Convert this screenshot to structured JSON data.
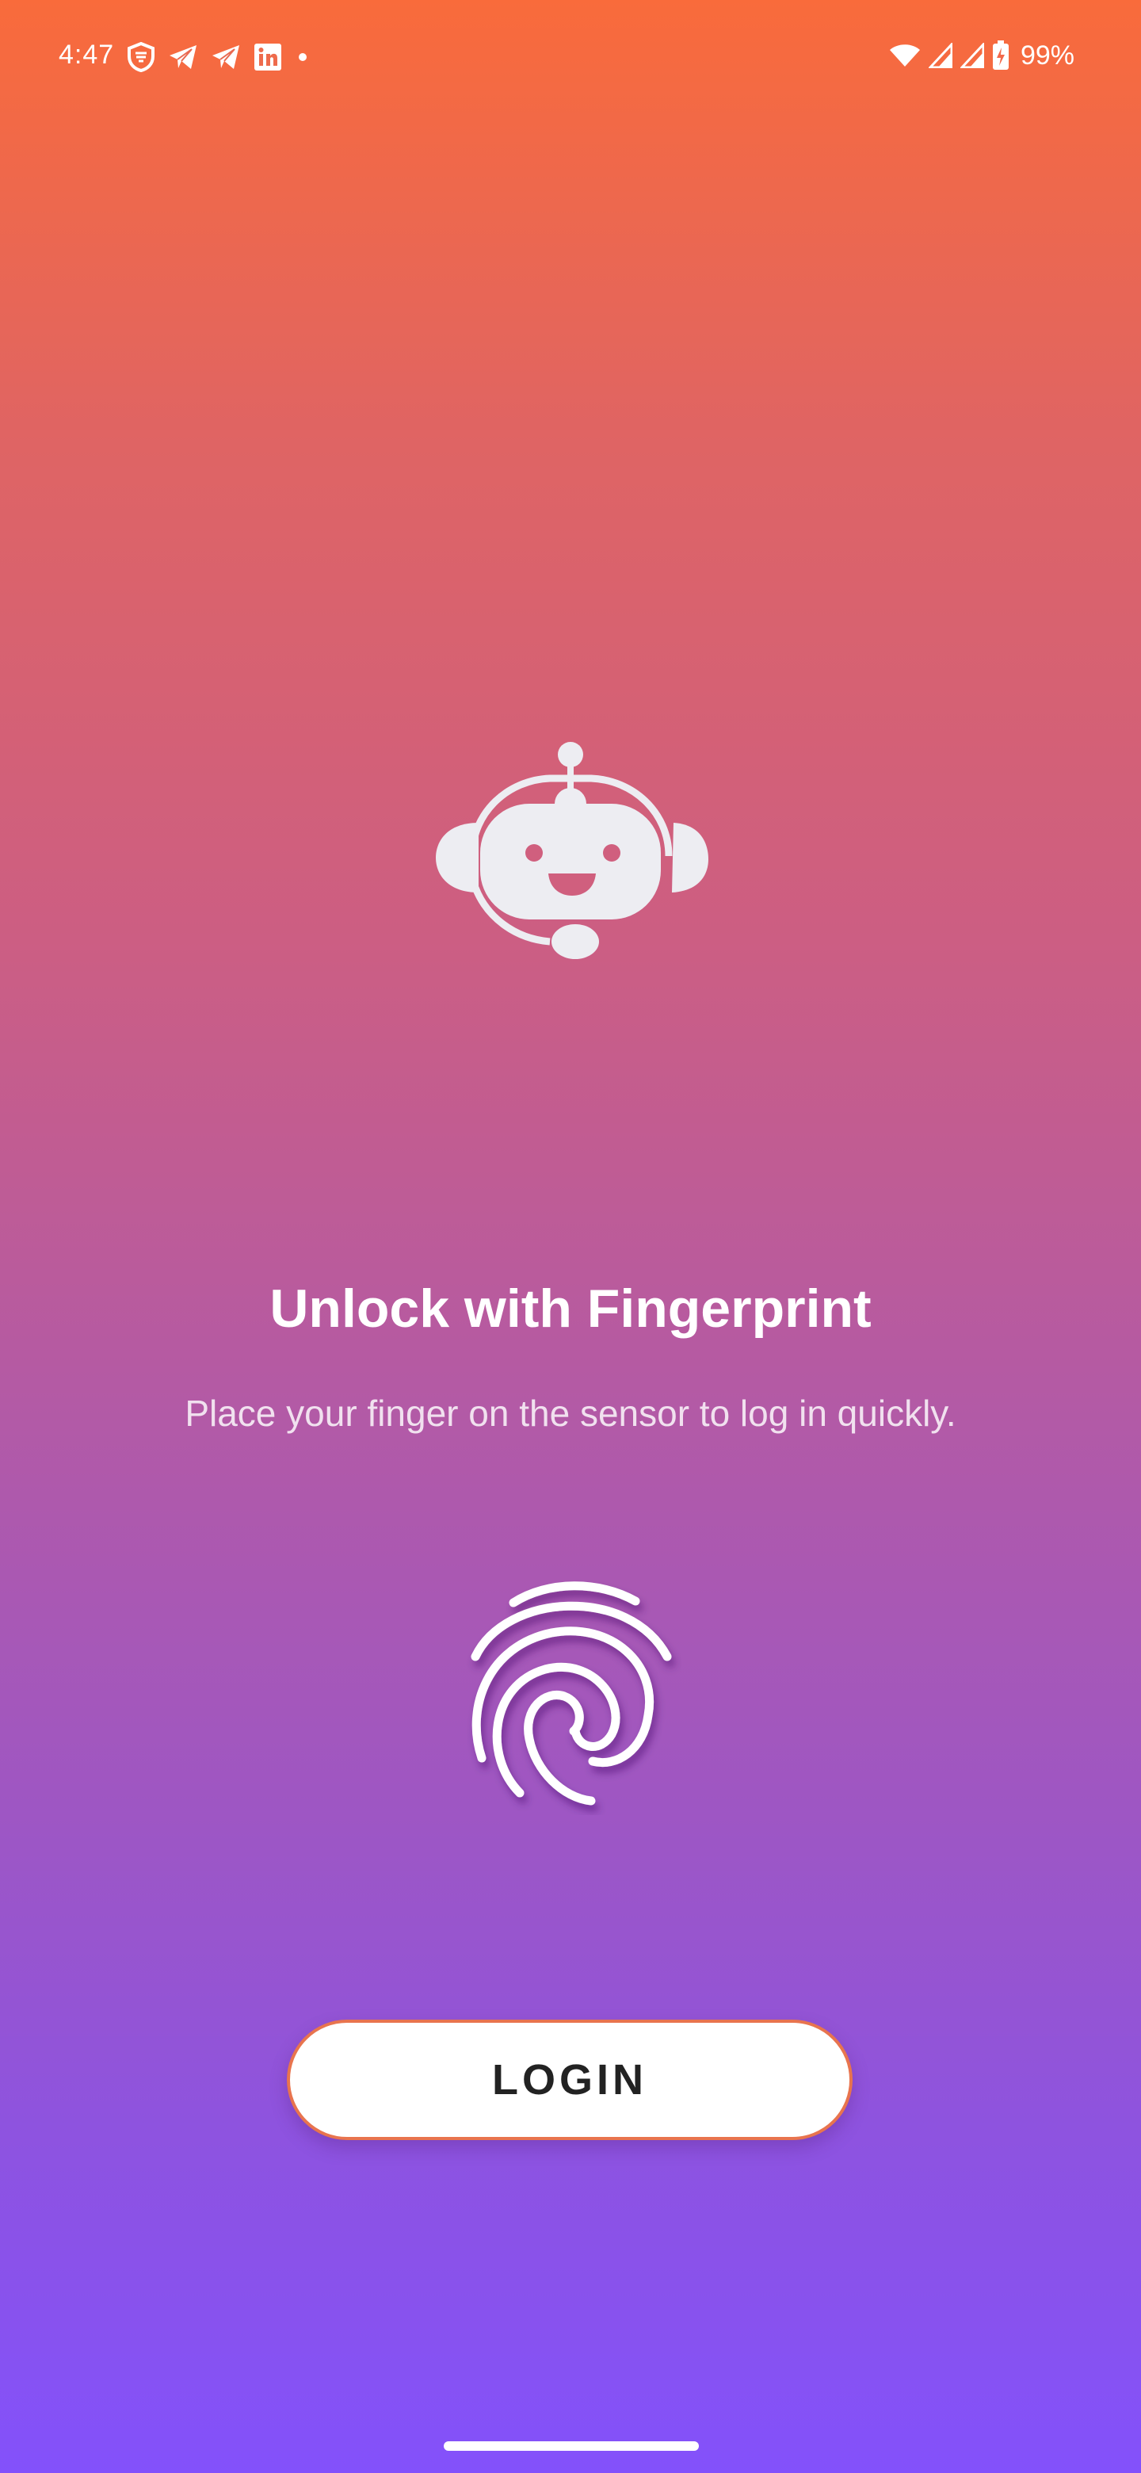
{
  "status_bar": {
    "time": "4:47",
    "left_icons": [
      "vpn-shield-icon",
      "telegram-icon",
      "telegram-icon",
      "linkedin-icon",
      "notification-dot-icon"
    ],
    "right_icons": [
      "wifi-icon",
      "signal-icon",
      "signal-icon",
      "battery-charging-icon"
    ],
    "battery": "99%"
  },
  "logo": {
    "icon": "robot-headset-icon"
  },
  "main": {
    "title": "Unlock with Fingerprint",
    "subtitle": "Place your finger on the sensor to log in quickly.",
    "fingerprint_icon": "fingerprint-icon"
  },
  "login_button": {
    "label": "LOGIN"
  },
  "colors": {
    "gradient_top": "#F96B3B",
    "gradient_mid": "#B45AA4",
    "gradient_bottom": "#8351FB",
    "button_border": "#E8744E",
    "icon_light": "#EDEDF2"
  }
}
